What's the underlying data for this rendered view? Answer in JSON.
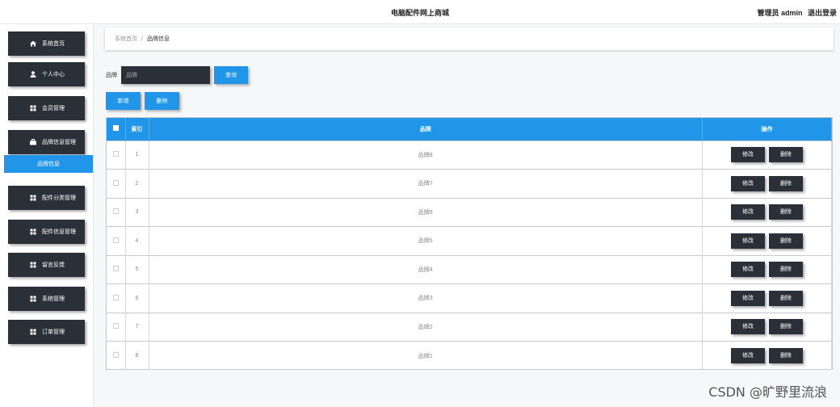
{
  "header": {
    "site_title": "电脑配件网上商城",
    "user_role": "管理员 admin",
    "logout_label": "退出登录"
  },
  "sidebar": {
    "items": [
      {
        "label": "系统首页",
        "icon": "home-icon"
      },
      {
        "label": "个人中心",
        "icon": "user-icon"
      },
      {
        "label": "会员管理",
        "icon": "grid-icon"
      },
      {
        "label": "品牌信息管理",
        "icon": "briefcase-icon"
      },
      {
        "label": "配件分类管理",
        "icon": "grid-icon"
      },
      {
        "label": "配件信息管理",
        "icon": "grid-icon"
      },
      {
        "label": "留言反馈",
        "icon": "grid-icon"
      },
      {
        "label": "系统管理",
        "icon": "grid-icon"
      },
      {
        "label": "订单管理",
        "icon": "grid-icon"
      }
    ],
    "active_sub": "品牌信息"
  },
  "breadcrumb": {
    "home": "系统首页",
    "current": "品牌信息"
  },
  "search": {
    "label": "品牌",
    "placeholder": "品牌",
    "button": "查询"
  },
  "actions": {
    "add": "新增",
    "delete": "删除"
  },
  "table": {
    "headers": {
      "index": "索引",
      "brand": "品牌",
      "ops": "操作"
    },
    "edit_label": "修改",
    "delete_label": "删除",
    "rows": [
      {
        "index": "1",
        "brand": "品牌8"
      },
      {
        "index": "2",
        "brand": "品牌7"
      },
      {
        "index": "3",
        "brand": "品牌6"
      },
      {
        "index": "4",
        "brand": "品牌5"
      },
      {
        "index": "5",
        "brand": "品牌4"
      },
      {
        "index": "6",
        "brand": "品牌3"
      },
      {
        "index": "7",
        "brand": "品牌2"
      },
      {
        "index": "8",
        "brand": "品牌1"
      }
    ]
  },
  "watermark": "CSDN @旷野里流浪",
  "colors": {
    "accent": "#2196e8",
    "dark": "#2b2f38"
  }
}
